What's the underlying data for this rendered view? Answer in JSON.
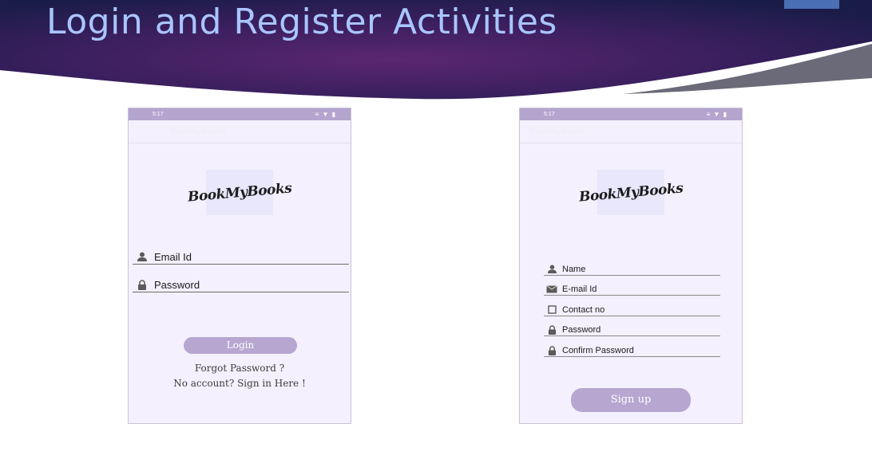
{
  "slide": {
    "title": "Login and Register Activities",
    "colors": {
      "banner_dark": "#1d1d4f",
      "banner_purple": "#5a2670",
      "title": "#a9c5ff"
    }
  },
  "login_screen": {
    "status_time": "5:17",
    "status_icons": "≡ ▼ ▮",
    "back_icon": "arrow-left-icon",
    "app_title": "BookmyBooks",
    "logo_text": "BookMyBooks",
    "fields": [
      {
        "label": "Email Id",
        "icon": "person-icon"
      },
      {
        "label": "Password",
        "icon": "lock-icon"
      }
    ],
    "login_button": "Login",
    "forgot_link": "Forgot Password ?",
    "signup_link": "No account? Sign in Here !"
  },
  "register_screen": {
    "status_time": "5:17",
    "status_icons": "≡ ▼ ▮",
    "app_title": "BookmyBooks",
    "logo_text": "BookMyBooks",
    "fields": [
      {
        "label": "Name",
        "icon": "person-icon"
      },
      {
        "label": "E-mail Id",
        "icon": "mail-icon"
      },
      {
        "label": "Contact no",
        "icon": "phone-icon"
      },
      {
        "label": "Password",
        "icon": "lock-icon"
      },
      {
        "label": "Confirm Password",
        "icon": "lock-icon"
      }
    ],
    "signup_button": "Sign up"
  }
}
